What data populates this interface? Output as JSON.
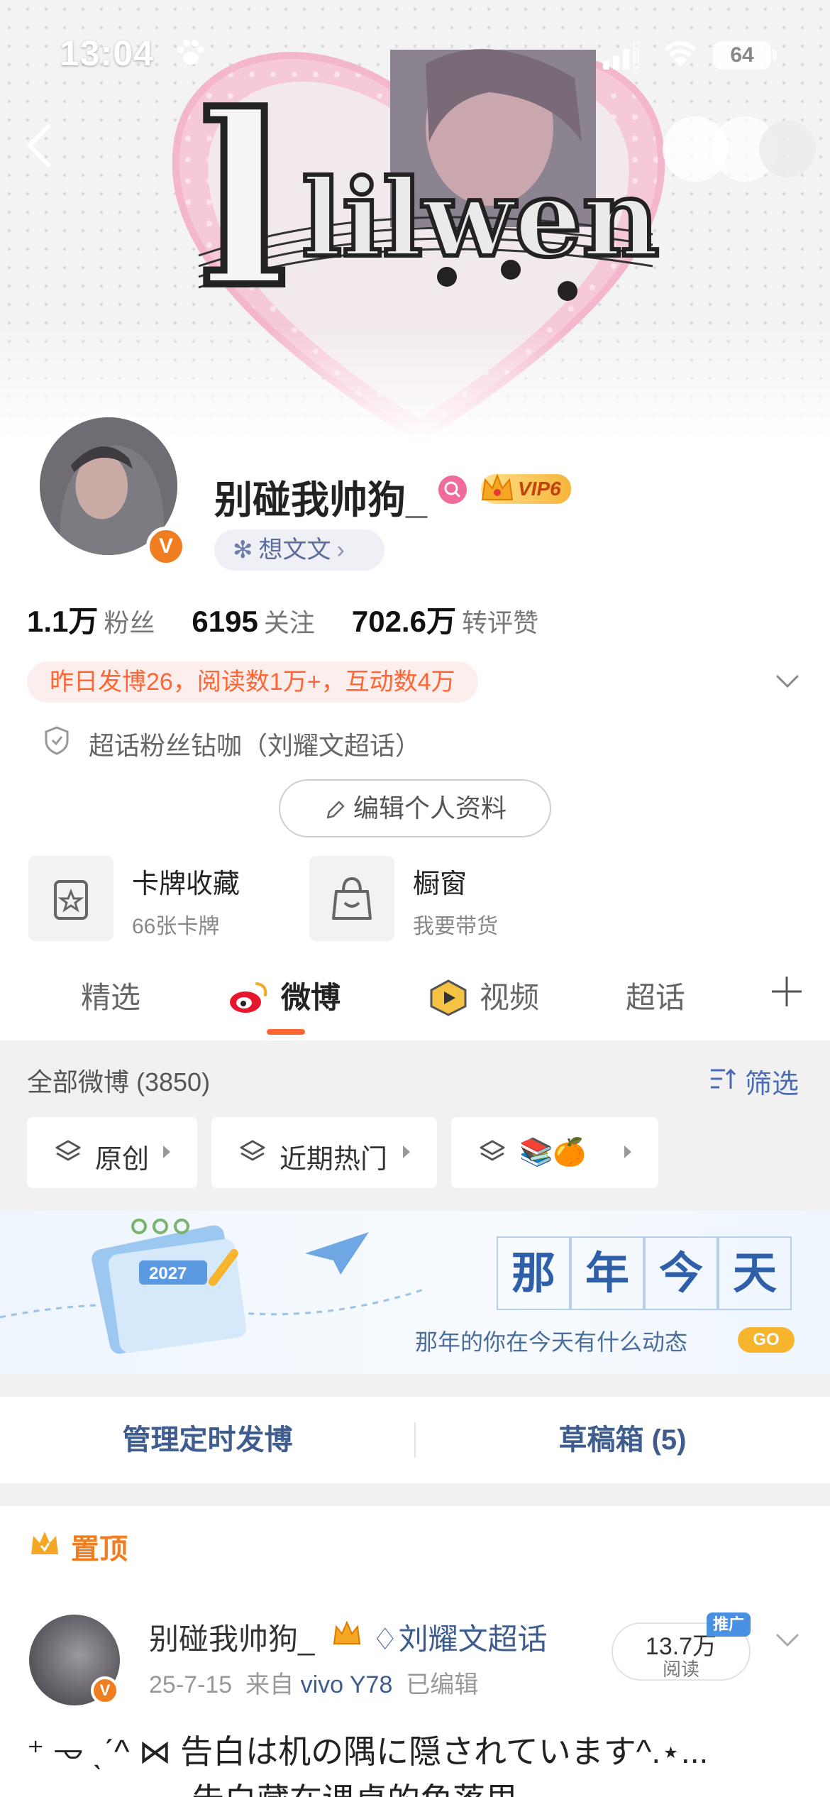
{
  "status_bar": {
    "time": "13:04",
    "battery": "64"
  },
  "cover": {
    "art_text": "lilwen"
  },
  "profile": {
    "username": "别碰我帅狗_",
    "vip_label": "VIP6",
    "mood_label": "想文文",
    "verified_badge": "V",
    "stats": [
      {
        "value": "1.1万",
        "label": "粉丝"
      },
      {
        "value": "6195",
        "label": "关注"
      },
      {
        "value": "702.6万",
        "label": "转评赞"
      }
    ],
    "activity": "昨日发博26，阅读数1万+，互动数4万",
    "supertopic_badge": "超话粉丝钻咖（刘耀文超话）",
    "edit_button": "编辑个人资料"
  },
  "tools": [
    {
      "title": "卡牌收藏",
      "subtitle": "66张卡牌",
      "icon": "card-star-icon"
    },
    {
      "title": "橱窗",
      "subtitle": "我要带货",
      "icon": "shopping-bag-icon"
    }
  ],
  "tabs": [
    {
      "label": "精选"
    },
    {
      "label": "微博"
    },
    {
      "label": "视频"
    },
    {
      "label": "超话"
    }
  ],
  "feed": {
    "all_posts": "全部微博 (3850)",
    "filter_label": "筛选",
    "chips": [
      {
        "label": "原创"
      },
      {
        "label": "近期热门"
      },
      {
        "label": "📚🍊"
      }
    ]
  },
  "banner": {
    "title_chars": [
      "那",
      "年",
      "今",
      "天"
    ],
    "subtitle": "那年的你在今天有什么动态",
    "go": "GO",
    "calendar_year": "2027"
  },
  "manage": {
    "scheduled": "管理定时发博",
    "drafts": "草稿箱 (5)"
  },
  "post": {
    "pinned": "置顶",
    "author": "别碰我帅狗_",
    "topic": "刘耀文超话",
    "date": "25-7-15",
    "source_prefix": "来自",
    "device": "vivo Y78",
    "edited": "已编辑",
    "reads_value": "13.7万",
    "reads_label": "阅读",
    "promo": "推广",
    "text_line1": "⁺ 𐃷 ˎˊ^ ⋈ 告白は机の隅に隠されています^.⋆...",
    "text_line2": "告白藏在课桌的角落里"
  },
  "colors": {
    "accent_orange": "#ff6633",
    "link_blue": "#3e5d8e",
    "vip_gold": "#f5b53b",
    "background_gray": "#f1f1f1"
  }
}
